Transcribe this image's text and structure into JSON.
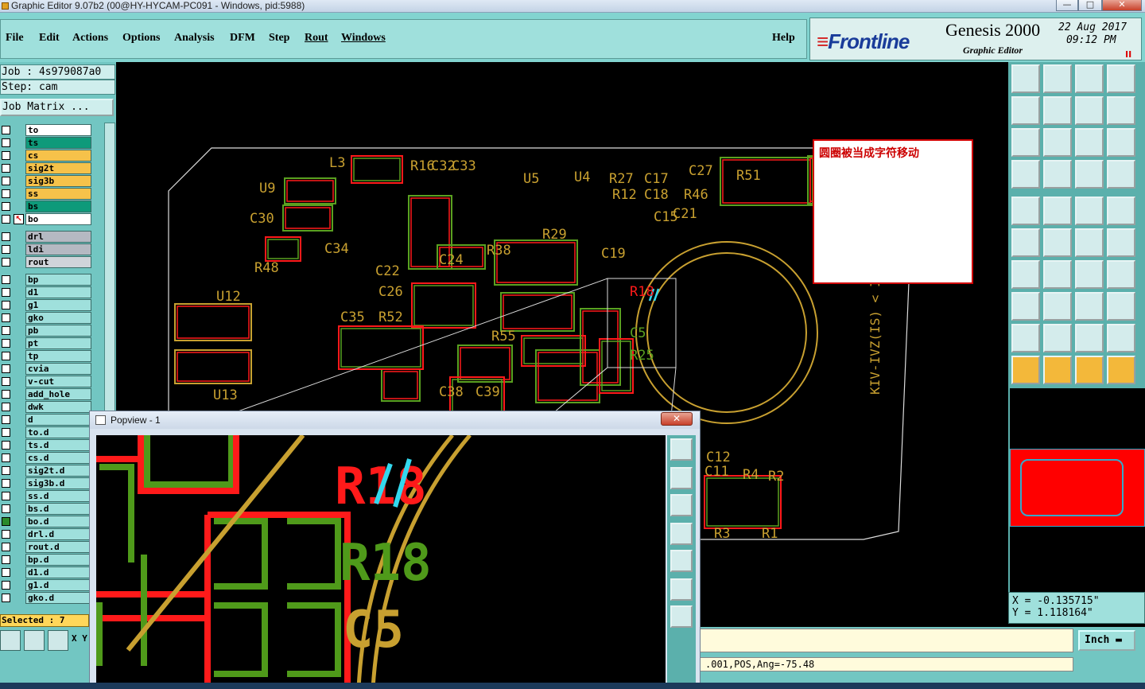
{
  "window": {
    "title": "Graphic Editor 9.07b2 (00@HY-HYCAM-PC091 - Windows, pid:5988)",
    "minimize": "—",
    "maximize": "□",
    "close": "✕"
  },
  "menu": {
    "items": [
      "File",
      "Edit",
      "Actions",
      "Options",
      "Analysis",
      "DFM",
      "Step",
      "Rout",
      "Windows"
    ],
    "help": "Help"
  },
  "brand": {
    "logo_e": "≡",
    "logo": "Frontline",
    "product": "Genesis 2000",
    "subtitle": "Graphic Editor",
    "date": "22 Aug 2017",
    "time": "09:12 PM",
    "pause": "II"
  },
  "left": {
    "job": "Job : 4s979087a0",
    "step": "Step: cam",
    "matrix_button": "Job Matrix ...",
    "selected": "Selected : 7",
    "xy_label": "X Y"
  },
  "layers": [
    {
      "name": "to",
      "color": "#ffffff"
    },
    {
      "name": "ts",
      "color": "#0e9a7a"
    },
    {
      "name": "cs",
      "color": "#f6c24a"
    },
    {
      "name": "sig2t",
      "color": "#f6c24a"
    },
    {
      "name": "sig3b",
      "color": "#f6c24a"
    },
    {
      "name": "ss",
      "color": "#f6c24a"
    },
    {
      "name": "bs",
      "color": "#0e9a7a"
    },
    {
      "name": "bo",
      "color": "#ffffff",
      "active": true
    },
    {
      "name": "drl",
      "color": "#b5b9c2"
    },
    {
      "name": "ldi",
      "color": "#b5b9c2"
    },
    {
      "name": "rout",
      "color": "#d0d4da"
    },
    {
      "name": "bp",
      "color": "#9fe0dc"
    },
    {
      "name": "d1",
      "color": "#9fe0dc"
    },
    {
      "name": "g1",
      "color": "#9fe0dc"
    },
    {
      "name": "gko",
      "color": "#9fe0dc"
    },
    {
      "name": "pb",
      "color": "#9fe0dc"
    },
    {
      "name": "pt",
      "color": "#9fe0dc"
    },
    {
      "name": "tp",
      "color": "#9fe0dc"
    },
    {
      "name": "cvia",
      "color": "#9fe0dc"
    },
    {
      "name": "v-cut",
      "color": "#9fe0dc"
    },
    {
      "name": "add_hole",
      "color": "#9fe0dc"
    },
    {
      "name": "dwk",
      "color": "#9fe0dc"
    },
    {
      "name": "d",
      "color": "#9fe0dc"
    },
    {
      "name": "to.d",
      "color": "#9fe0dc"
    },
    {
      "name": "ts.d",
      "color": "#9fe0dc"
    },
    {
      "name": "cs.d",
      "color": "#9fe0dc"
    },
    {
      "name": "sig2t.d",
      "color": "#9fe0dc"
    },
    {
      "name": "sig3b.d",
      "color": "#9fe0dc"
    },
    {
      "name": "ss.d",
      "color": "#9fe0dc"
    },
    {
      "name": "bs.d",
      "color": "#9fe0dc"
    },
    {
      "name": "bo.d",
      "color": "#9fe0dc",
      "marked": true
    },
    {
      "name": "drl.d",
      "color": "#9fe0dc"
    },
    {
      "name": "rout.d",
      "color": "#9fe0dc"
    },
    {
      "name": "bp.d",
      "color": "#9fe0dc"
    },
    {
      "name": "d1.d",
      "color": "#9fe0dc"
    },
    {
      "name": "g1.d",
      "color": "#9fe0dc"
    },
    {
      "name": "gko.d",
      "color": "#9fe0dc"
    }
  ],
  "canvas": {
    "labels": [
      "L3",
      "U9",
      "C30",
      "C34",
      "R48",
      "C22",
      "C26",
      "C24",
      "R38",
      "C19",
      "R29",
      "U5",
      "U4",
      "R27",
      "C17",
      "C27",
      "R12",
      "C18",
      "R46",
      "C15",
      "C21",
      "R51",
      "U12",
      "R52",
      "C35",
      "R55",
      "R18",
      "C5",
      "R25",
      "C38",
      "C39",
      "U13",
      "C12",
      "C11",
      "R4",
      "R2",
      "R3",
      "R1",
      "R16",
      "C32",
      "C33"
    ],
    "board_text": "KIV-IVZ(IS) < IO"
  },
  "annotation": {
    "text": "圆圈被当成字符移动"
  },
  "coords": {
    "x": "X = -0.135715\"",
    "y": "Y = 1.118164\""
  },
  "status": {
    "command": "",
    "message": ".001,POS,Ang=-75.48",
    "units": "Inch"
  },
  "popview": {
    "title": "Popview - 1",
    "close": "✕",
    "labels": [
      "R18",
      "R18",
      "C5"
    ]
  },
  "colors": {
    "panel": "#82d4d0",
    "red_layer": "#ff1a1a",
    "green_layer": "#4f9a1a",
    "gold_layer": "#c8a030",
    "highlight": "#33d8ee"
  }
}
